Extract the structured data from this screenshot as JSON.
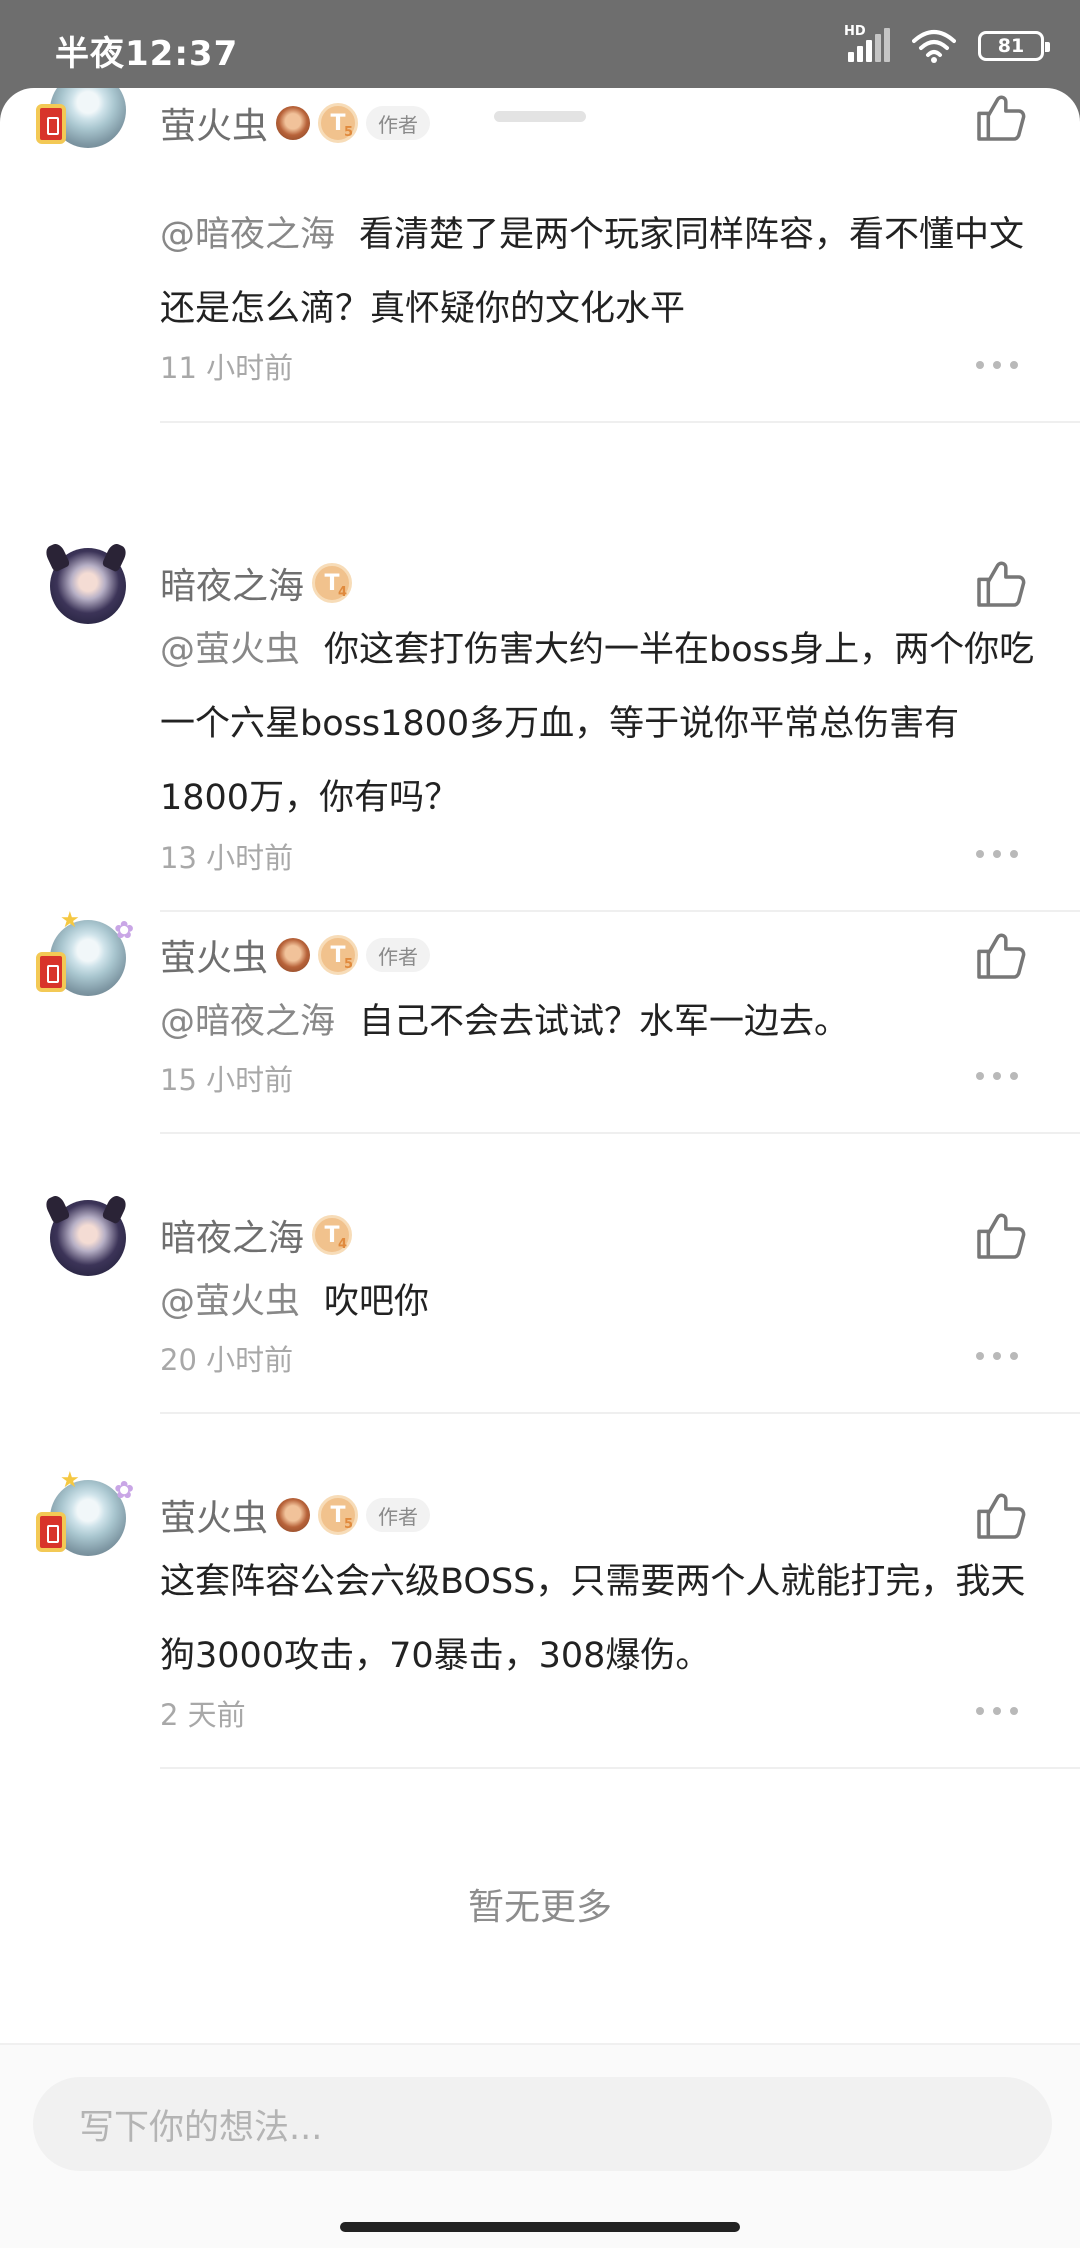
{
  "status_bar": {
    "time": "半夜12:37",
    "network": "HD",
    "battery": "81"
  },
  "comments": [
    {
      "username": "萤火虫",
      "author_tag": "作者",
      "level": "T",
      "level_num": "5",
      "mention": "@暗夜之海",
      "text": "看清楚了是两个玩家同样阵容，看不懂中文还是怎么滴？真怀疑你的文化水平",
      "time": "11 小时前"
    },
    {
      "username": "暗夜之海",
      "level": "T",
      "level_num": "4",
      "mention": "@萤火虫",
      "text": "你这套打伤害大约一半在boss身上，两个你吃一个六星boss1800多万血，等于说你平常总伤害有1800万，你有吗？",
      "time": "13 小时前"
    },
    {
      "username": "萤火虫",
      "author_tag": "作者",
      "level": "T",
      "level_num": "5",
      "mention": "@暗夜之海",
      "text": "自己不会去试试？水军一边去。",
      "time": "15 小时前"
    },
    {
      "username": "暗夜之海",
      "level": "T",
      "level_num": "4",
      "mention": "@萤火虫",
      "text": "吹吧你",
      "time": "20 小时前"
    },
    {
      "username": "萤火虫",
      "author_tag": "作者",
      "level": "T",
      "level_num": "5",
      "mention": "",
      "text": "这套阵容公会六级BOSS，只需要两个人就能打完，我天狗3000攻击，70暴击，308爆伤。",
      "time": "2 天前"
    }
  ],
  "footer": {
    "no_more": "暂无更多"
  },
  "input": {
    "placeholder": "写下你的想法..."
  },
  "icons": {
    "like": "thumbs-up-icon",
    "more": "more-dots-icon"
  },
  "colors": {
    "badge": "#f1c28d",
    "text": "#222222",
    "muted": "#a8a8a8"
  }
}
